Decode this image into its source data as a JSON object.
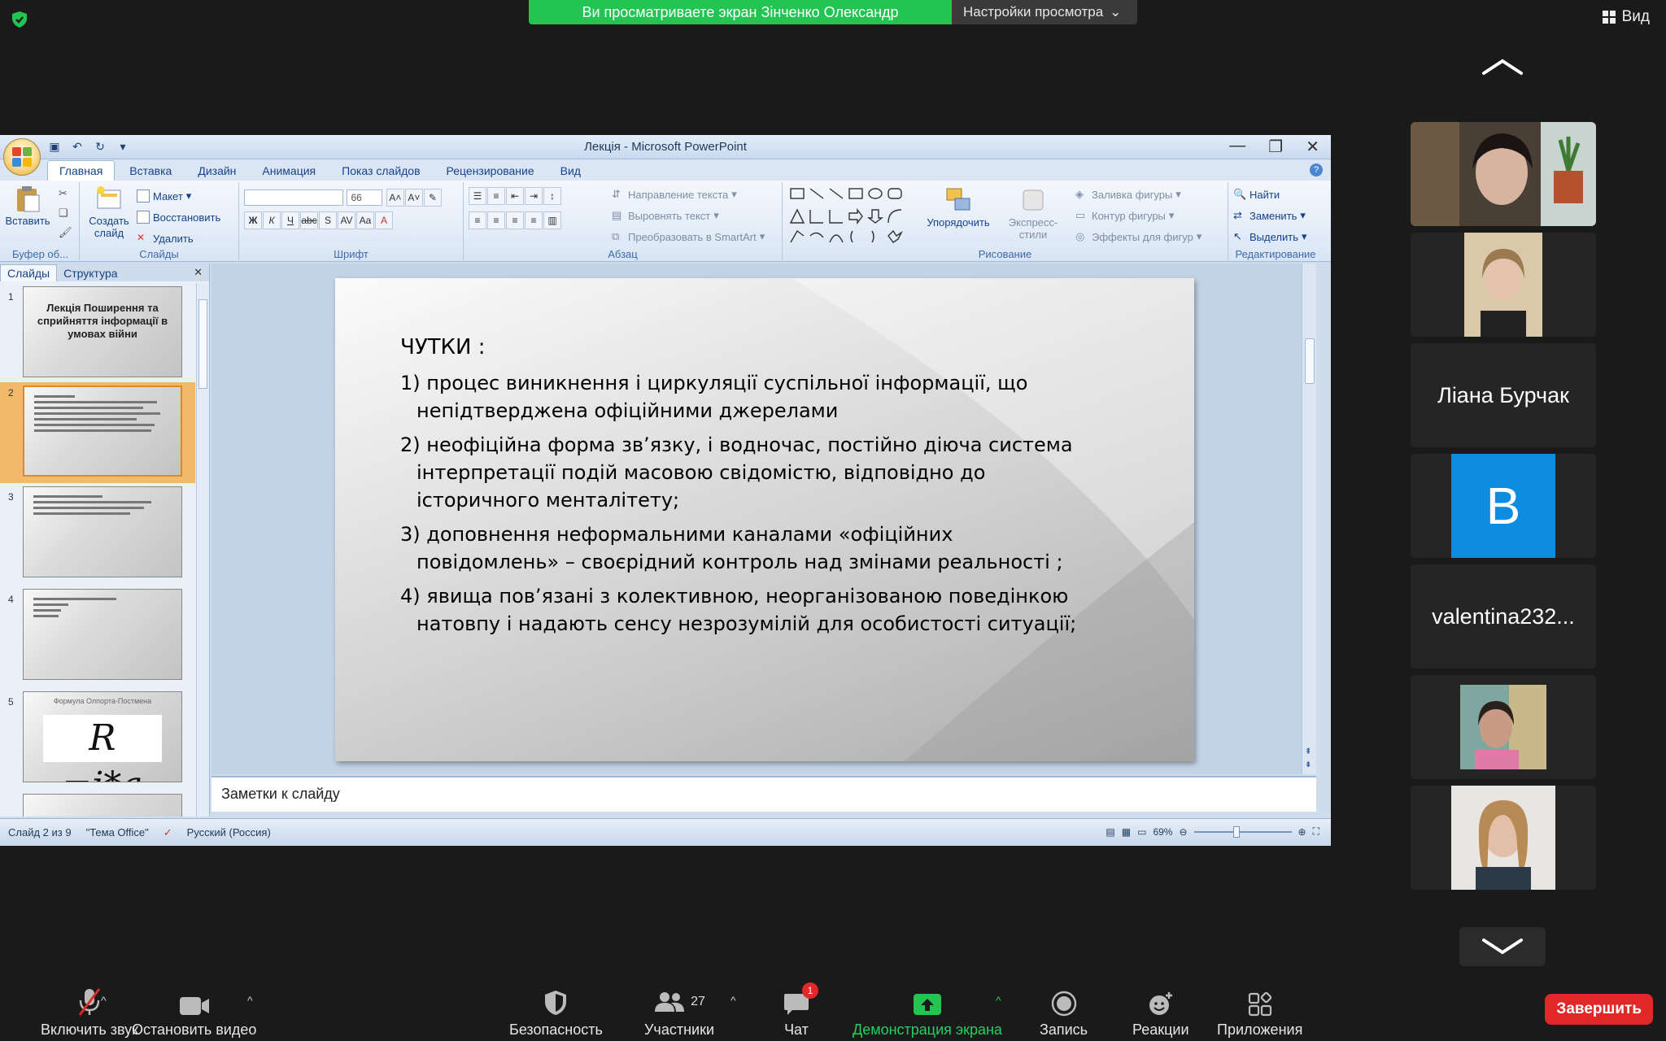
{
  "zoom": {
    "share_banner": "Ви просматриваете экран Зінченко Олександр",
    "view_options": "Настройки просмотра",
    "view_button": "Вид",
    "participants_tiles": [
      {
        "type": "video",
        "name": ""
      },
      {
        "type": "video",
        "name": ""
      },
      {
        "type": "name",
        "name": "Ліана Бурчак"
      },
      {
        "type": "avatar",
        "letter": "B"
      },
      {
        "type": "name",
        "name": "valentina232..."
      },
      {
        "type": "video",
        "name": ""
      },
      {
        "type": "video",
        "name": ""
      }
    ],
    "toolbar": {
      "mute": "Включить звук",
      "video": "Остановить видео",
      "security": "Безопасность",
      "participants": "Участники",
      "participants_count": "27",
      "chat": "Чат",
      "chat_badge": "1",
      "share": "Демонстрация экрана",
      "record": "Запись",
      "reactions": "Реакции",
      "apps": "Приложения",
      "end": "Завершить"
    }
  },
  "ppt": {
    "window_title": "Лекція - Microsoft PowerPoint",
    "tabs": [
      "Главная",
      "Вставка",
      "Дизайн",
      "Анимация",
      "Показ слайдов",
      "Рецензирование",
      "Вид"
    ],
    "ribbon": {
      "clipboard": {
        "paste": "Вставить",
        "label": "Буфер об..."
      },
      "slides": {
        "new_slide": "Создать слайд",
        "layout": "Макет",
        "reset": "Восстановить",
        "delete": "Удалить",
        "label": "Слайды"
      },
      "font": {
        "size": "66",
        "label": "Шрифт"
      },
      "paragraph": {
        "text_direction": "Направление текста",
        "align_text": "Выровнять текст",
        "smartart": "Преобразовать в SmartArt",
        "label": "Абзац"
      },
      "drawing": {
        "arrange": "Упорядочить",
        "quick_styles": "Экспресс-стили",
        "shape_fill": "Заливка фигуры",
        "shape_outline": "Контур фигуры",
        "shape_effects": "Эффекты для фигур",
        "label": "Рисование"
      },
      "editing": {
        "find": "Найти",
        "replace": "Заменить",
        "select": "Выделить",
        "label": "Редактирование"
      }
    },
    "side_tabs": {
      "slides": "Слайды",
      "outline": "Структура"
    },
    "thumbnails": [
      {
        "num": "1",
        "title": "Лекція Поширення та сприйняття інформації в умовах війни"
      },
      {
        "num": "2",
        "selected": true
      },
      {
        "num": "3"
      },
      {
        "num": "4"
      },
      {
        "num": "5",
        "subtitle": "Формула Олпорта-Постмена",
        "formula": "R =i*a"
      }
    ],
    "slide": {
      "title": "ЧУТКИ :",
      "items": [
        {
          "line1": "1) процес виникнення і циркуляції суспільної інформації, що",
          "cont": "непідтверджена офіційними джерелами"
        },
        {
          "line1": "2)  неофіційна форма зв’язку, і водночас, постійно діюча система",
          "cont": "інтерпретації подій масовою свідомістю, відповідно до історичного менталітету;"
        },
        {
          "line1": "3) доповнення неформальними каналами «офіційних",
          "cont": "повідомлень»  –  своєрідний контроль над змінами реальності ;"
        },
        {
          "line1": "4) явища пов’язані з колективною, неорганізованою поведінкою",
          "cont": "натовпу і надають сенсу незрозумілій для особистості ситуації;"
        }
      ]
    },
    "notes_placeholder": "Заметки к слайду",
    "status": {
      "slide_info": "Слайд 2 из 9",
      "theme": "\"Тема Office\"",
      "language": "Русский (Россия)",
      "zoom": "69%"
    }
  }
}
